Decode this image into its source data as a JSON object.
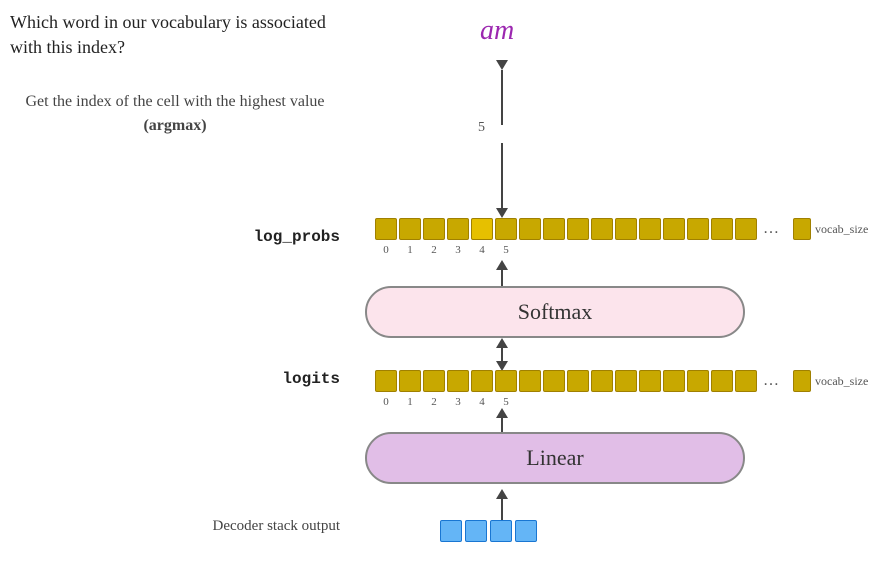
{
  "leftPanel": {
    "question": "Which word in our vocabulary is associated with this index?",
    "argmaxDesc": "Get the index of the cell with the highest value",
    "argmaxLabel": "(argmax)",
    "logitsLabel": "logits",
    "logProbsLabel": "log_probs",
    "decoderLabel": "Decoder stack output"
  },
  "diagram": {
    "wordOutput": "am",
    "indexNumber": "5",
    "softmaxLabel": "Softmax",
    "linearLabel": "Linear",
    "cellIndices": [
      "0",
      "1",
      "2",
      "3",
      "4",
      "5"
    ],
    "vocabSizeLabel": "vocab_size",
    "ellipsis": "…"
  }
}
